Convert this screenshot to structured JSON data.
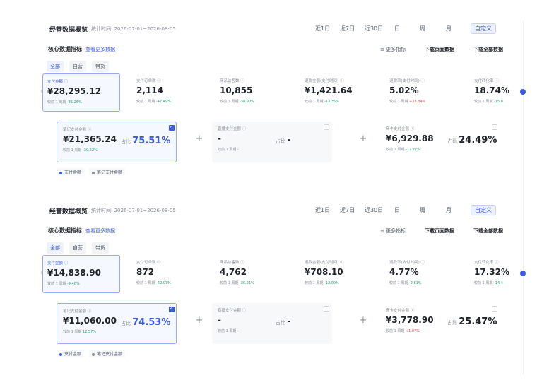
{
  "panels": [
    {
      "title": "经营数据概览",
      "stat_time": "统计时间: 2026-07-01~2026-08-05",
      "ranges": [
        "近1日",
        "近7日",
        "近30日",
        "日",
        "周",
        "月",
        "自定义"
      ],
      "active_range": "自定义",
      "core_title": "核心数据指标",
      "more_data": "查看更多数据",
      "more_metrics": "更多指标",
      "download_page": "下载页面数据",
      "download_all": "下载全部数据",
      "tabs": [
        "全部",
        "自营",
        "带货"
      ],
      "metrics": [
        {
          "label": "支付金额",
          "value": "¥28,295.12",
          "cmp": "较前 1 周期",
          "delta": "-35.26%",
          "dir": "down"
        },
        {
          "label": "支付订单数",
          "value": "2,114",
          "cmp": "较前 1 周期",
          "delta": "-47.49%",
          "dir": "down"
        },
        {
          "label": "商品访客数",
          "value": "10,855",
          "cmp": "较前 1 周期",
          "delta": "-38.90%",
          "dir": "down"
        },
        {
          "label": "退款金额(支付时间)",
          "value": "¥1,421.64",
          "cmp": "较前 1 周期",
          "delta": "-13.35%",
          "dir": "down"
        },
        {
          "label": "退款率(支付时间)",
          "value": "5.02%",
          "cmp": "较前 1 周期",
          "delta": "+33.84%",
          "dir": "up"
        },
        {
          "label": "支付转化率",
          "value": "18.74%",
          "cmp": "较前 1 周期",
          "delta": "-15.8",
          "dir": "down"
        }
      ],
      "subcards": [
        {
          "label": "笔记支付金额",
          "value": "¥21,365.24",
          "cmp": "较前 1 周期",
          "delta": "-39.52%",
          "dir": "down",
          "share_label": "占比",
          "share": "75.51%"
        },
        {
          "label": "直播支付金额",
          "value": "-",
          "cmp": "较前 1 周期",
          "delta": "-",
          "dir": "none",
          "share_label": "占比",
          "share": "-"
        },
        {
          "label": "商卡支付金额",
          "value": "¥6,929.88",
          "cmp": "较前 1 周期",
          "delta": "-17.27%",
          "dir": "down",
          "share_label": "占比",
          "share": "24.49%"
        }
      ],
      "legend": [
        "支付金额",
        "笔记支付金额"
      ]
    },
    {
      "title": "经营数据概览",
      "stat_time": "统计时间: 2026-07-01~2026-08-05",
      "ranges": [
        "近1日",
        "近7日",
        "近30日",
        "日",
        "周",
        "月",
        "自定义"
      ],
      "active_range": "自定义",
      "core_title": "核心数据指标",
      "more_data": "查看更多数据",
      "more_metrics": "更多指标",
      "download_page": "下载页面数据",
      "download_all": "下载全部数据",
      "tabs": [
        "全部",
        "自营",
        "带货"
      ],
      "metrics": [
        {
          "label": "支付金额",
          "value": "¥14,838.90",
          "cmp": "较前 1 周期",
          "delta": "-9.46%",
          "dir": "down"
        },
        {
          "label": "支付订单数",
          "value": "872",
          "cmp": "较前 1 周期",
          "delta": "-42.07%",
          "dir": "down"
        },
        {
          "label": "商品访客数",
          "value": "4,762",
          "cmp": "较前 1 周期",
          "delta": "-35.21%",
          "dir": "down"
        },
        {
          "label": "退款金额(支付时间)",
          "value": "¥708.10",
          "cmp": "较前 1 周期",
          "delta": "-12.00%",
          "dir": "down"
        },
        {
          "label": "退款率(支付时间)",
          "value": "4.77%",
          "cmp": "较前 1 周期",
          "delta": "-2.81%",
          "dir": "down"
        },
        {
          "label": "支付转化率",
          "value": "17.32%",
          "cmp": "较前 1 周期",
          "delta": "-14.4",
          "dir": "down"
        }
      ],
      "subcards": [
        {
          "label": "笔记支付金额",
          "value": "¥11,060.00",
          "cmp": "较前 1 周期",
          "delta": "12.57%",
          "dir": "down",
          "share_label": "占比",
          "share": "74.53%"
        },
        {
          "label": "直播支付金额",
          "value": "-",
          "cmp": "较前 1 周期",
          "delta": "-",
          "dir": "none",
          "share_label": "占比",
          "share": "-"
        },
        {
          "label": "商卡支付金额",
          "value": "¥3,778.90",
          "cmp": "较前 1 周期",
          "delta": "+1.07%",
          "dir": "up",
          "share_label": "占比",
          "share": "25.47%"
        }
      ],
      "legend": [
        "支付金额",
        "笔记支付金额"
      ]
    }
  ],
  "colors": {
    "accent": "#3b5bdb",
    "down": "#22a06b",
    "up": "#e5484d"
  },
  "icons": {
    "more_metrics": "list-icon",
    "info": "info-circle-icon",
    "add": "plus-icon"
  }
}
